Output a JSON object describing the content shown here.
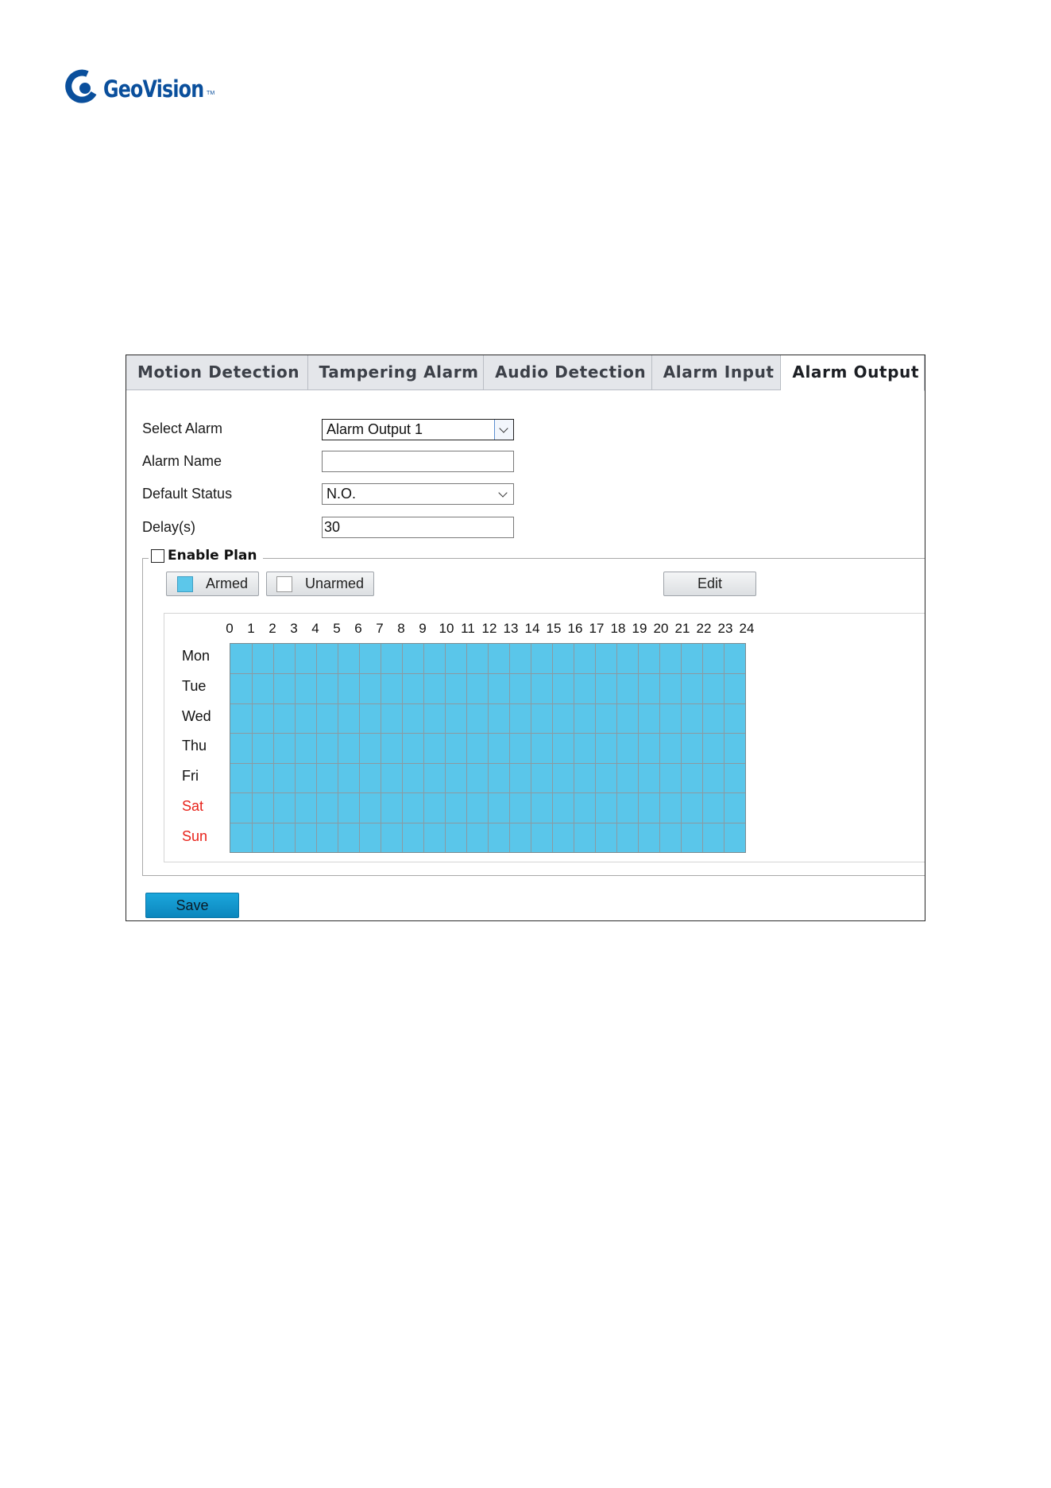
{
  "brand": {
    "name": "GeoVision",
    "tm": "TM",
    "color": "#0a4f9c"
  },
  "tabs": [
    {
      "label": "Motion Detection",
      "active": false
    },
    {
      "label": "Tampering Alarm",
      "active": false
    },
    {
      "label": "Audio Detection",
      "active": false
    },
    {
      "label": "Alarm Input",
      "active": false
    },
    {
      "label": "Alarm Output",
      "active": true
    }
  ],
  "form": {
    "select_alarm": {
      "label": "Select Alarm",
      "value": "Alarm Output 1"
    },
    "alarm_name": {
      "label": "Alarm Name",
      "value": ""
    },
    "default_status": {
      "label": "Default Status",
      "value": "N.O."
    },
    "delay": {
      "label": "Delay(s)",
      "value": "30"
    }
  },
  "plan": {
    "enable_label": "Enable Plan",
    "enabled": false,
    "armed_label": "Armed",
    "unarmed_label": "Unarmed",
    "edit_label": "Edit",
    "armed_color": "#5ac6ea",
    "hours": [
      "0",
      "1",
      "2",
      "3",
      "4",
      "5",
      "6",
      "7",
      "8",
      "9",
      "10",
      "11",
      "12",
      "13",
      "14",
      "15",
      "16",
      "17",
      "18",
      "19",
      "20",
      "21",
      "22",
      "23",
      "24"
    ],
    "days": [
      {
        "label": "Mon",
        "weekend": false
      },
      {
        "label": "Tue",
        "weekend": false
      },
      {
        "label": "Wed",
        "weekend": false
      },
      {
        "label": "Thu",
        "weekend": false
      },
      {
        "label": "Fri",
        "weekend": false
      },
      {
        "label": "Sat",
        "weekend": true
      },
      {
        "label": "Sun",
        "weekend": true
      }
    ]
  },
  "save_label": "Save"
}
